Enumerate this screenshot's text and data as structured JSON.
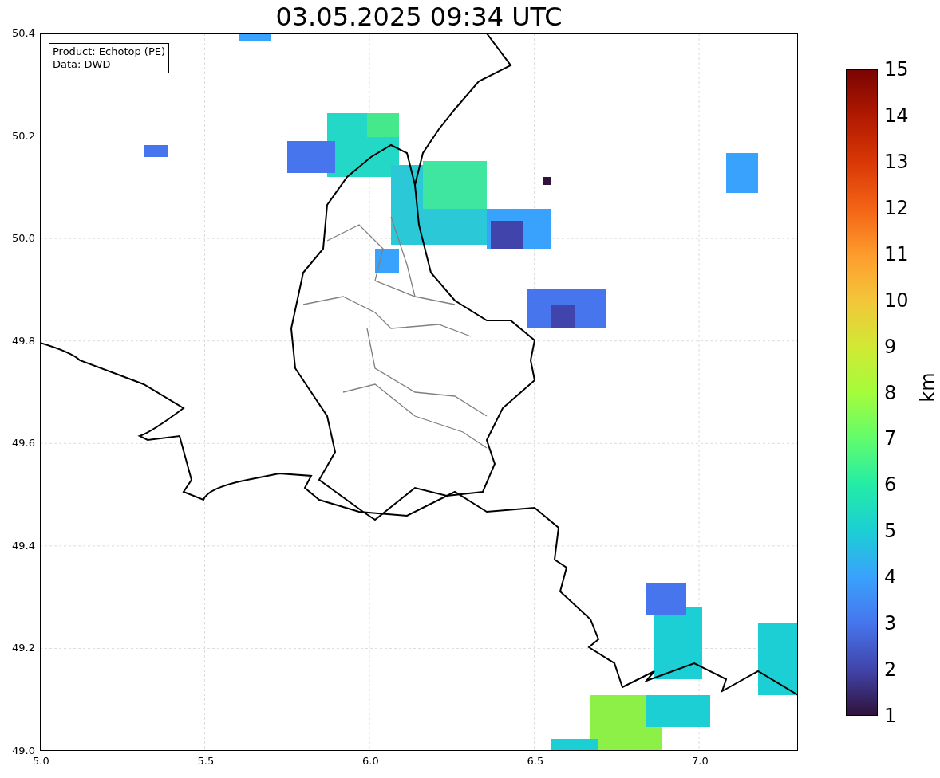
{
  "title": "03.05.2025 09:34 UTC",
  "legend": {
    "lines": [
      "Product: Echotop (PE)",
      "Data: DWD"
    ]
  },
  "map": {
    "xticks": [
      "5.0",
      "5.5",
      "6.0",
      "6.5",
      "7.0"
    ],
    "yticks": [
      "50.4",
      "50.2",
      "50.0",
      "49.8",
      "49.6",
      "49.4",
      "49.2",
      "49.0"
    ]
  },
  "colorbar": {
    "label": "km",
    "ticks": [
      "15",
      "14",
      "13",
      "12",
      "11",
      "10",
      "9",
      "8",
      "7",
      "6",
      "5",
      "4",
      "3",
      "2",
      "1"
    ]
  }
}
